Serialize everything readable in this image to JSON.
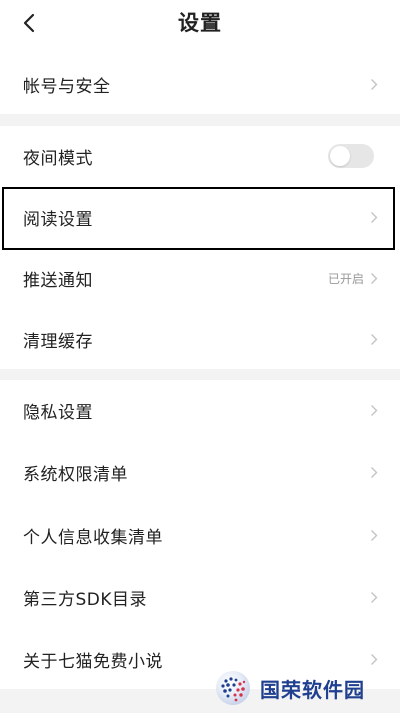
{
  "header": {
    "title": "设置",
    "back_icon": "chevron-left-icon"
  },
  "rows": {
    "account": {
      "label": "帐号与安全"
    },
    "night_mode": {
      "label": "夜间模式",
      "toggle_on": false
    },
    "reading": {
      "label": "阅读设置"
    },
    "push": {
      "label": "推送通知",
      "value": "已开启"
    },
    "cache": {
      "label": "清理缓存"
    },
    "privacy": {
      "label": "隐私设置"
    },
    "permissions": {
      "label": "系统权限清单"
    },
    "personal_info": {
      "label": "个人信息收集清单"
    },
    "sdk": {
      "label": "第三方SDK目录"
    },
    "about": {
      "label": "关于七猫免费小说"
    }
  },
  "watermark": {
    "text": "国荣软件园",
    "logo": "globe-logo"
  },
  "colors": {
    "background": "#ffffff",
    "section_gap": "#f3f3f3",
    "text": "#222222",
    "secondary_text": "#999999",
    "toggle_off": "#e6e6e6",
    "watermark_text": "#1f3f8f"
  }
}
